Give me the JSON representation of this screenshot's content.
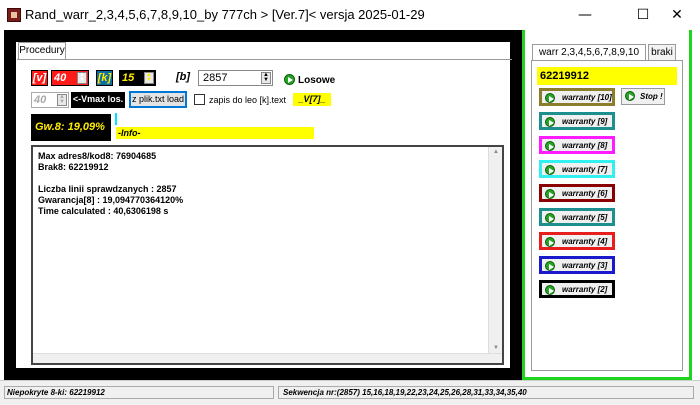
{
  "window": {
    "title": "Rand_warr_2,3,4,5,6,7,8,9,10_by 777ch > [Ver.7]<   versja 2025-01-29",
    "min_glyph": "—",
    "max_glyph": "☐",
    "close_glyph": "✕"
  },
  "left": {
    "tab_label": "Procedury",
    "v_label": "[v]",
    "v_value": "40",
    "k_label": "[k]",
    "k_value": "15",
    "b_label": "[b]",
    "b_value": "2857",
    "losowe_label": "Losowe",
    "disabled_value": "40",
    "vmax_button": "<-Vmax los.",
    "load_button": "z plik.txt load",
    "checkbox_label": "zapis do leo [k].text",
    "v7_label": "_V[7]_",
    "gw_label": "Gw.8: 19,09%",
    "info_label": "-Info-",
    "output_lines": "Max adres8/kod8: 76904685\nBrak8: 62219912\n\nLiczba linii sprawdzanych : 2857\nGwarancja[8] : 19,094770364120%\nTime calculated : 40,6306198 s"
  },
  "right": {
    "tab_warr": "warr 2,3,4,5,6,7,8,9,10",
    "tab_braki": "braki",
    "number": "62219912",
    "stop_label": "Stop !",
    "warranty_buttons": [
      {
        "label": "warranty [10]",
        "color": "#8b7d2a"
      },
      {
        "label": "warranty [9]",
        "color": "#1e8f8f"
      },
      {
        "label": "warranty [8]",
        "color": "#ff1aff"
      },
      {
        "label": "warranty [7]",
        "color": "#33f0f0"
      },
      {
        "label": "warranty [6]",
        "color": "#8b0000"
      },
      {
        "label": "warranty [5]",
        "color": "#1e8f8f"
      },
      {
        "label": "warranty [4]",
        "color": "#e81e1e"
      },
      {
        "label": "warranty [3]",
        "color": "#1a1acc"
      },
      {
        "label": "warranty [2]",
        "color": "#000000"
      }
    ]
  },
  "status": {
    "left": "Niepokryte 8-ki: 62219912",
    "right": "Sekwencja nr:(2857)  15,16,18,19,22,23,24,25,26,28,31,33,34,35,40"
  },
  "colors": {
    "accent_green": "#1ed41e",
    "v_red": "#ff1a1a",
    "k_blue": "#0c6da0",
    "highlight_yellow": "#ffff00"
  }
}
